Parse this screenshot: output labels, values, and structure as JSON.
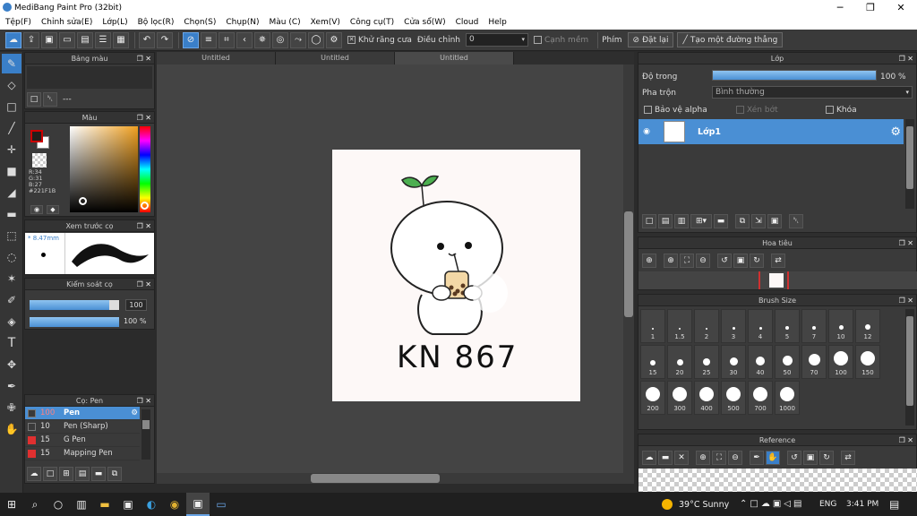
{
  "window": {
    "title": "MediBang Paint Pro (32bit)"
  },
  "menu": [
    "Tệp(F)",
    "Chỉnh sửa(E)",
    "Lớp(L)",
    "Bộ lọc(R)",
    "Chọn(S)",
    "Chụp(N)",
    "Màu (C)",
    "Xem(V)",
    "Công cụ(T)",
    "Cửa sổ(W)",
    "Cloud",
    "Help"
  ],
  "toolbar": {
    "antialias_label": "Khử răng cưa",
    "adjust_label": "Điều chỉnh",
    "adjust_value": "0",
    "edge_label": "Cạnh mềm",
    "key_label": "Phím",
    "reset_label": "Đặt lại",
    "straight_label": "Tạo một đường thẳng"
  },
  "panels": {
    "palette_title": "Bảng màu",
    "palette_text": "---",
    "color_title": "Màu",
    "rgb": {
      "r": "R:34",
      "g": "G:31",
      "b": "B:27",
      "hex": "#221F1B"
    },
    "preview_title": "Xem trước cọ",
    "preview_size": "8.47mm",
    "brush_control_title": "Kiểm soát cọ",
    "brush_size_value": "100",
    "brush_opacity_value": "100 %",
    "brush_list_title": "Cọ: Pen",
    "brushes": [
      {
        "size": "100",
        "name": "Pen",
        "color": "#3a3a3a"
      },
      {
        "size": "10",
        "name": "Pen (Sharp)",
        "color": "#3a3a3a"
      },
      {
        "size": "15",
        "name": "G Pen",
        "color": "#e03030"
      },
      {
        "size": "15",
        "name": "Mapping Pen",
        "color": "#e03030"
      }
    ]
  },
  "tabs": [
    "Untitled",
    "Untitled",
    "Untitled"
  ],
  "layer_panel": {
    "title": "Lớp",
    "opacity_label": "Độ trong",
    "opacity_value": "100 %",
    "opacity_fraction": 1.0,
    "blend_label": "Pha trộn",
    "blend_value": "Bình thường",
    "alpha_label": "Bảo vệ alpha",
    "clip_label": "Xén bớt",
    "lock_label": "Khóa",
    "layer_name": "Lớp1"
  },
  "navigator_title": "Hoa tiêu",
  "brush_size_panel": {
    "title": "Brush Size",
    "sizes": [
      "1",
      "1.5",
      "2",
      "3",
      "4",
      "5",
      "7",
      "10",
      "12",
      "15",
      "20",
      "25",
      "30",
      "40",
      "50",
      "70",
      "100",
      "150",
      "200",
      "300",
      "400",
      "500",
      "700",
      "1000"
    ]
  },
  "reference_title": "Reference",
  "artwork_text": "KN 867",
  "taskbar": {
    "weather": "39°C  Sunny",
    "lang": "ENG",
    "time": "3:41 PM"
  },
  "colors": {
    "accent": "#3a7fc8",
    "current_color": "#221F1B",
    "layer_highlight": "#4a8fd4"
  }
}
